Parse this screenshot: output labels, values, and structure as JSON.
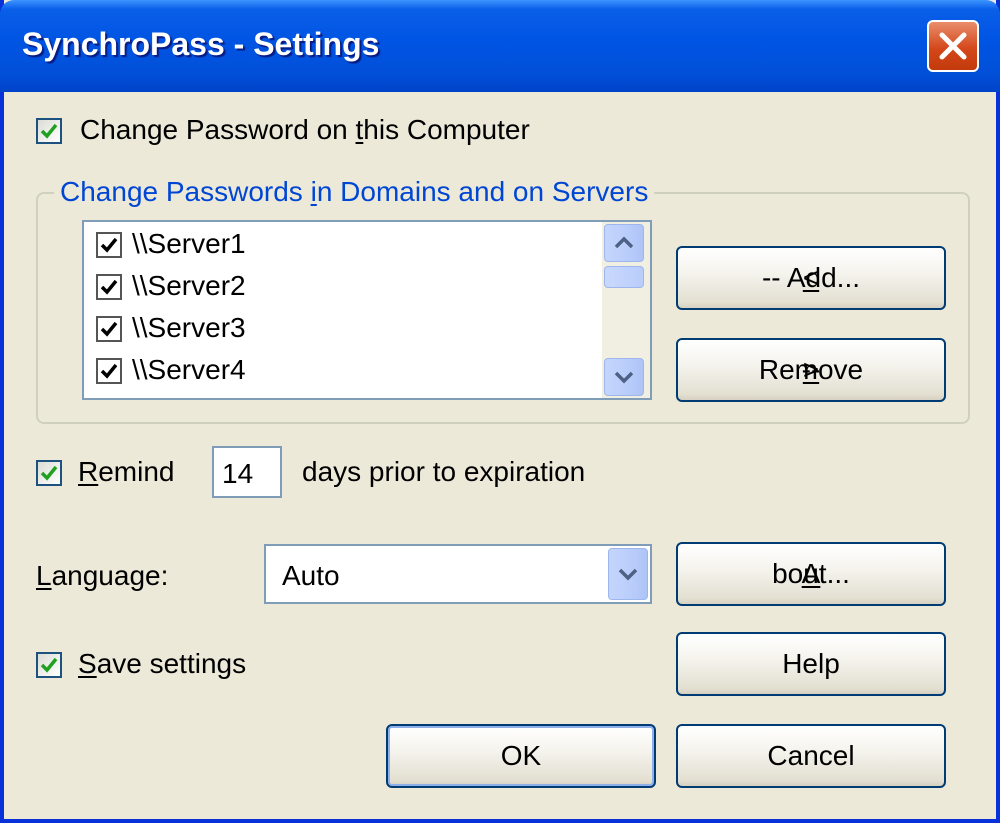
{
  "window": {
    "title": "SynchroPass - Settings"
  },
  "local": {
    "checked": true,
    "label_pre": "Change Password on ",
    "label_mnemonic": "t",
    "label_post": "his Computer"
  },
  "group": {
    "title_pre": "Change Passwords ",
    "title_mnemonic": "i",
    "title_post": "n Domains and on Servers"
  },
  "servers": [
    {
      "label": "\\\\Server1",
      "checked": true
    },
    {
      "label": "\\\\Server2",
      "checked": true
    },
    {
      "label": "\\\\Server3",
      "checked": true
    },
    {
      "label": "\\\\Server4",
      "checked": true
    }
  ],
  "buttons": {
    "add": {
      "mnemonic": "<",
      "rest": "-- Add..."
    },
    "remove": {
      "pre": "--",
      "mnemonic": ">",
      "rest": " Remove"
    },
    "about": {
      "mnemonic": "A",
      "rest": "bout..."
    },
    "help": "Help",
    "ok": "OK",
    "cancel": "Cancel"
  },
  "remind": {
    "checked": true,
    "mnemonic": "R",
    "rest": "emind",
    "days": "14",
    "suffix": "days prior to expiration"
  },
  "language": {
    "label_mnemonic": "L",
    "label_rest": "anguage:",
    "selected": "Auto"
  },
  "save": {
    "checked": true,
    "mnemonic": "S",
    "rest": "ave settings"
  },
  "colors": {
    "title_bar": "#0054e3",
    "dialog_bg": "#ece9d8",
    "group_title": "#0046d5",
    "checkmark": "#21a121"
  },
  "icons": {
    "close": "close-icon",
    "scroll_up": "chevron-up-icon",
    "scroll_down": "chevron-down-icon",
    "dropdown": "chevron-down-icon",
    "check": "checkmark-icon"
  }
}
